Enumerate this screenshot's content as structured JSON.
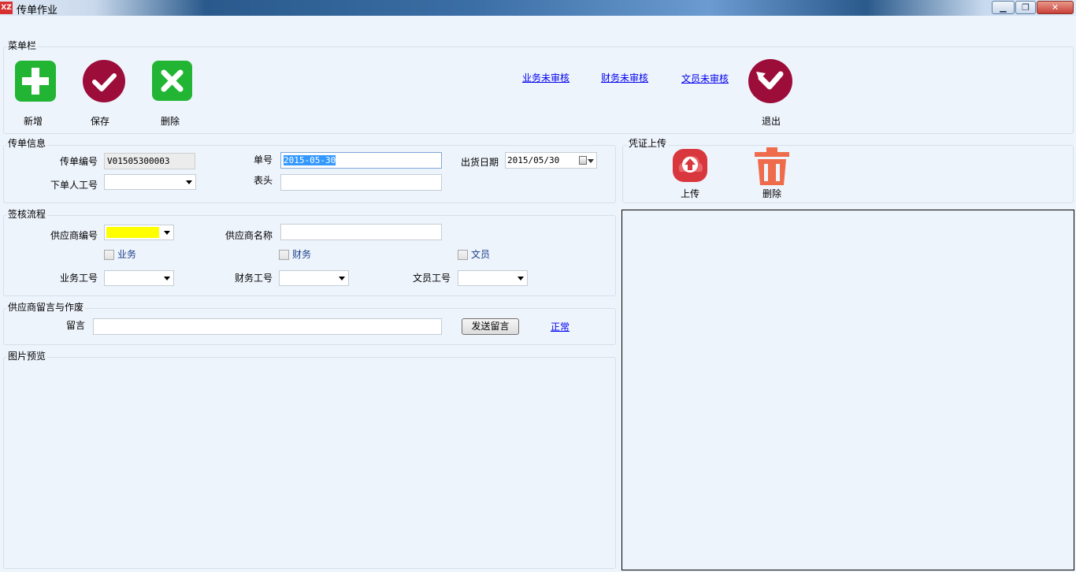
{
  "window": {
    "title": "传单作业",
    "app_icon_text": "XZ",
    "minimize": "▁",
    "maximize": "❐",
    "close": "✕"
  },
  "menu": {
    "group_label": "菜单栏",
    "add_label": "新增",
    "save_label": "保存",
    "delete_label": "删除",
    "exit_label": "退出",
    "links": [
      "业务未审核",
      "财务未审核",
      "文员未审核"
    ],
    "colors": {
      "add": "#22b534",
      "save": "#9c0d3a",
      "delete": "#22b534",
      "exit": "#9c0d3a"
    }
  },
  "order_info": {
    "group_label": "传单信息",
    "order_no_label": "传单编号",
    "order_no_value": "V01505300003",
    "bill_no_label": "单号",
    "bill_no_value": "2015-05-30",
    "ship_date_label": "出货日期",
    "ship_date_value": "2015/05/30",
    "orderer_id_label": "下单人工号",
    "header_label": "表头"
  },
  "approval": {
    "group_label": "签核流程",
    "supplier_no_label": "供应商编号",
    "supplier_name_label": "供应商名称",
    "chk_business": "业务",
    "chk_finance": "财务",
    "chk_clerk": "文员",
    "business_id_label": "业务工号",
    "finance_id_label": "财务工号",
    "clerk_id_label": "文员工号"
  },
  "message": {
    "group_label": "供应商留言与作废",
    "message_label": "留言",
    "send_button": "发送留言",
    "status_link": "正常"
  },
  "preview": {
    "group_label": "图片预览"
  },
  "voucher": {
    "group_label": "凭证上传",
    "upload_label": "上传",
    "delete_label": "删除",
    "colors": {
      "upload": "#d9373e",
      "delete": "#ee6b4b"
    }
  }
}
